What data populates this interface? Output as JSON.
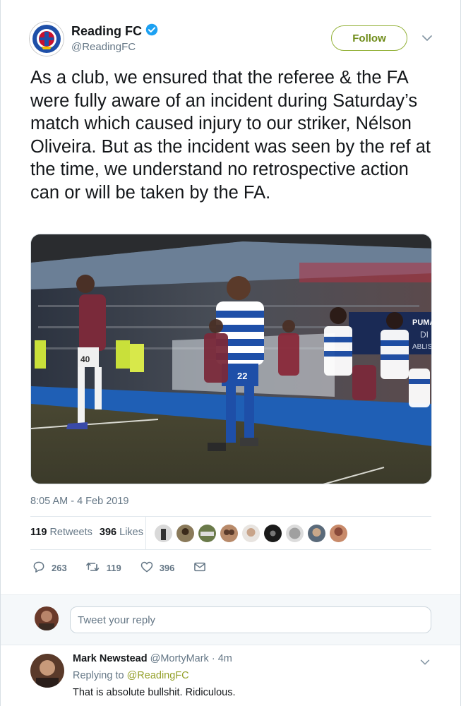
{
  "tweet": {
    "display_name": "Reading FC",
    "handle": "@ReadingFC",
    "follow_label": "Follow",
    "text": "As a club, we ensured that the referee & the FA were fully aware of an incident during Saturday’s match which caused injury to our striker, Nélson Oliveira. But as the incident was seen by the ref at the time, we understand no retrospective action can or will be taken by the FA.",
    "timestamp": "8:05 AM - 4 Feb 2019",
    "retweets_count": "119",
    "retweets_label": "Retweets",
    "likes_count": "396",
    "likes_label": "Likes",
    "liker_count": 9,
    "actions": {
      "replies": "263",
      "retweets": "119",
      "likes": "396"
    },
    "media": {
      "kit_numbers": [
        "40",
        "22"
      ],
      "board_text": [
        "PUMA",
        "DI",
        "ABLIS"
      ]
    }
  },
  "reply_box": {
    "placeholder": "Tweet your reply"
  },
  "reply": {
    "author": "Mark Newstead",
    "handle": "@MortyMark",
    "age": "4m",
    "replying_to_prefix": "Replying to",
    "replying_to_handle": "@ReadingFC",
    "text": "That is absolute bullshit. Ridiculous."
  },
  "colors": {
    "accent": "#94b23a",
    "text": "#14171a",
    "muted": "#657786",
    "verified": "#1da1f2",
    "reading_blue": "#1e4fa8"
  },
  "icons": [
    "verified-badge-icon",
    "chevron-down-icon",
    "reply-icon",
    "retweet-icon",
    "heart-icon",
    "dm-envelope-icon"
  ]
}
